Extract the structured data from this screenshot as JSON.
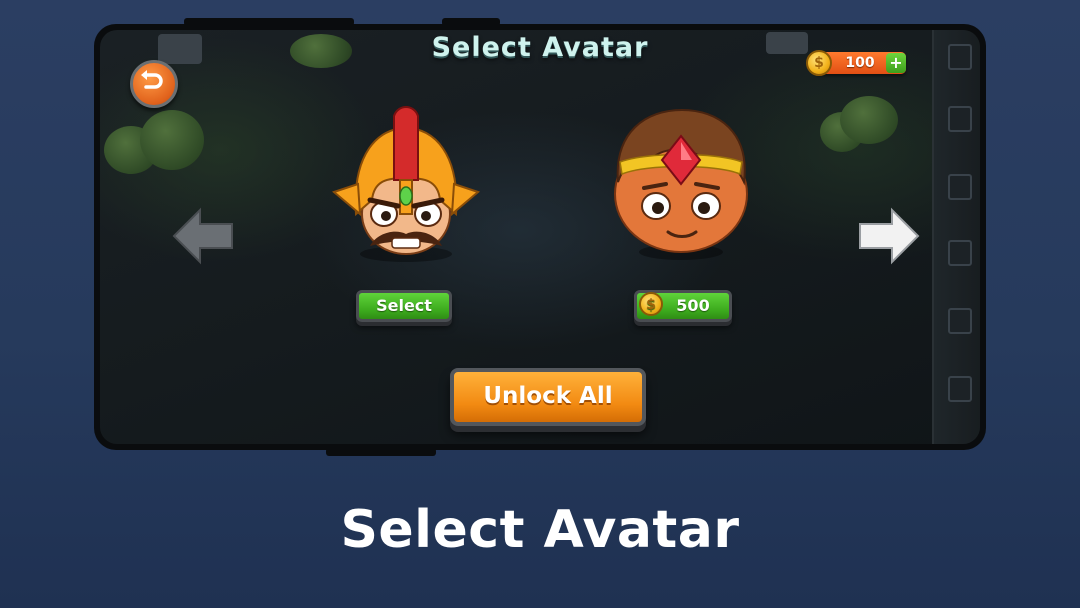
{
  "screen": {
    "title": "Select Avatar",
    "coins": {
      "balance": "100",
      "add_label": "+"
    },
    "avatars": [
      {
        "name": "warrior-helmet",
        "button_label": "Select",
        "locked": false
      },
      {
        "name": "jewel-crown-boy",
        "button_label": "500",
        "locked": true
      }
    ],
    "unlock_all_label": "Unlock All"
  },
  "caption": "Select Avatar",
  "icons": {
    "back": "undo-arrow-icon",
    "prev": "arrow-left-icon",
    "next": "arrow-right-icon",
    "coin": "coin-icon"
  },
  "colors": {
    "background": "#2b3e62",
    "title": "#cff3ee",
    "select_button": "#4cbf28",
    "unlock_button": "#f5981c",
    "coin_bar": "#f0641f"
  }
}
